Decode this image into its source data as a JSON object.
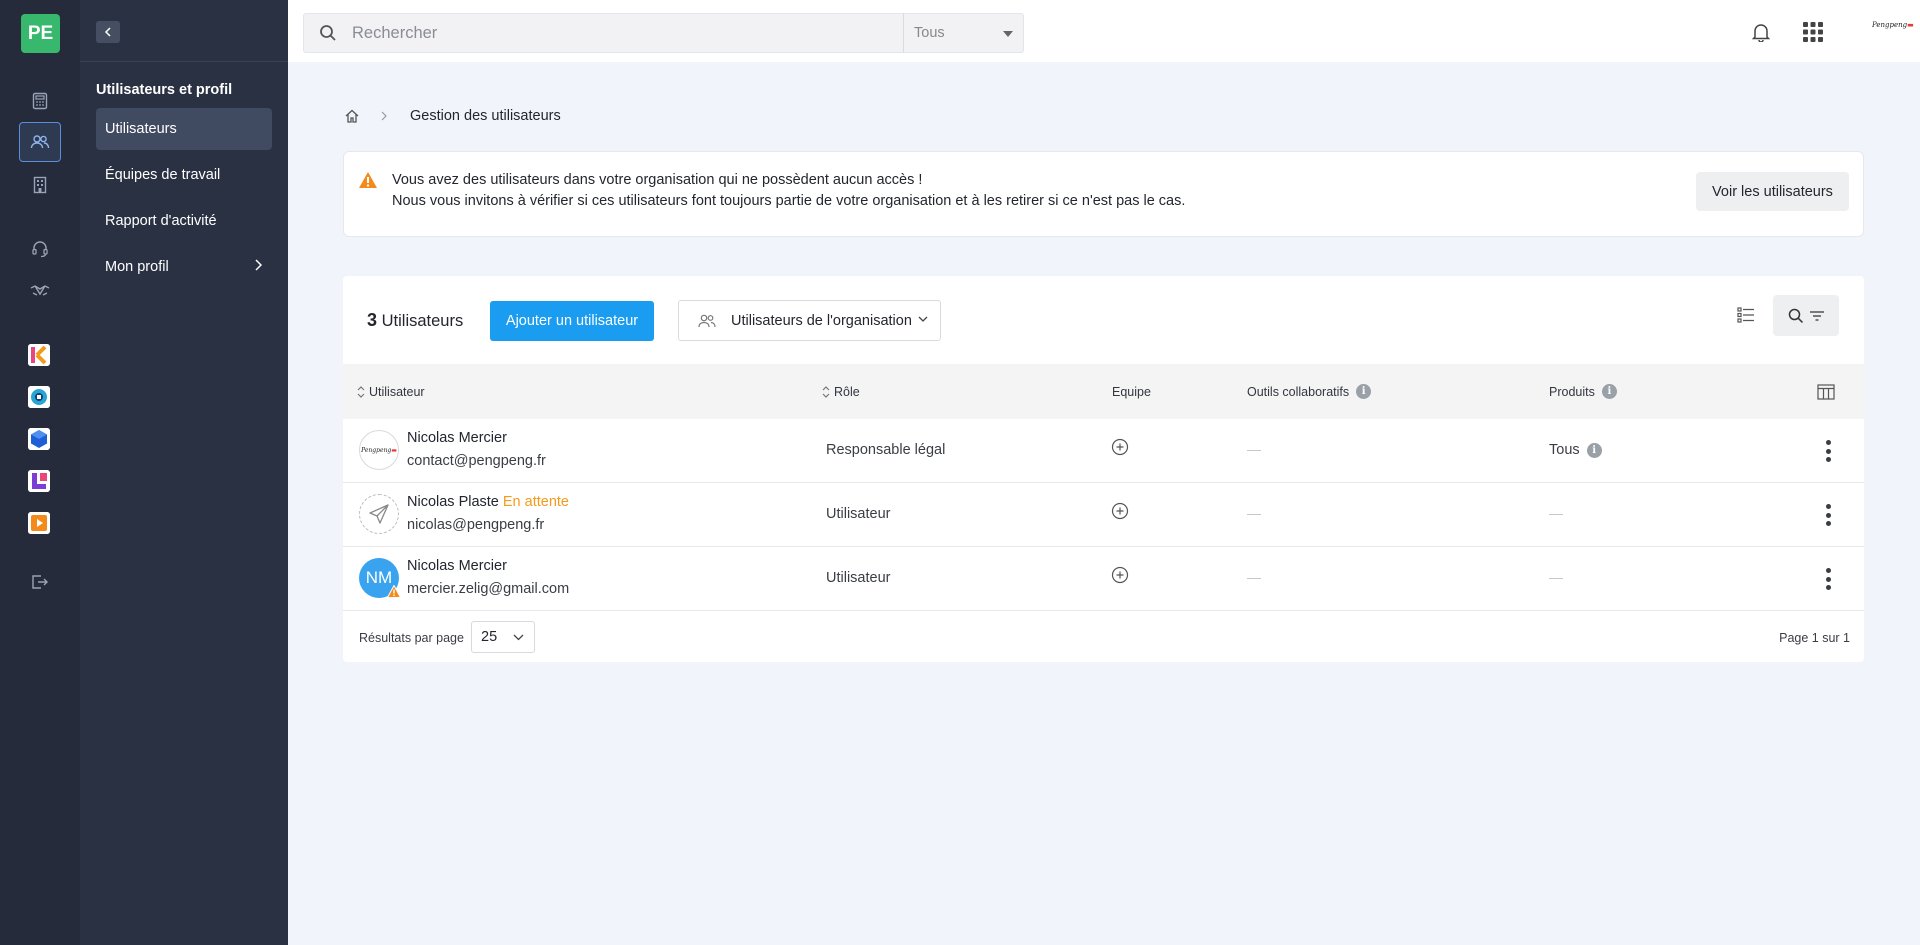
{
  "rail": {
    "logo_text": "PE",
    "logo_color": "#38b86c",
    "accent": "#5a8fd8",
    "icons": [
      "calculator-icon",
      "users-icon",
      "building-icon",
      "headset-icon",
      "handshake-icon"
    ],
    "apps": [
      {
        "name": "k-app-icon",
        "color": "#e8467c"
      },
      {
        "name": "blue-circle-app-icon",
        "color": "#27a6d6"
      },
      {
        "name": "blue-cube-app-icon",
        "color": "#1f5fd6"
      },
      {
        "name": "purple-app-icon",
        "color": "#7b3fd6"
      },
      {
        "name": "orange-play-app-icon",
        "color": "#f28a1c"
      }
    ]
  },
  "subnav": {
    "section_title": "Utilisateurs et profil",
    "items": [
      {
        "label": "Utilisateurs",
        "active": true
      },
      {
        "label": "Équipes de travail"
      },
      {
        "label": "Rapport d'activité"
      },
      {
        "label": "Mon profil",
        "has_chevron": true
      }
    ]
  },
  "topbar": {
    "search_placeholder": "Rechercher",
    "scope_value": "Tous",
    "brand_text": "Pengpeng"
  },
  "breadcrumb": {
    "current": "Gestion des utilisateurs"
  },
  "alert": {
    "line1": "Vous avez des utilisateurs dans votre organisation qui ne possèdent aucun accès !",
    "line2": "Nous vous invitons à vérifier si ces utilisateurs font toujours partie de votre organisation et à les retirer si ce n'est pas le cas.",
    "button": "Voir les utilisateurs"
  },
  "users": {
    "count": "3",
    "count_label": "Utilisateurs",
    "add_button": "Ajouter un utilisateur",
    "filter_dropdown": "Utilisateurs de l'organisation",
    "columns": {
      "user": "Utilisateur",
      "role": "Rôle",
      "team": "Equipe",
      "tools": "Outils collaboratifs",
      "products": "Produits"
    },
    "rows": [
      {
        "name": "Nicolas Mercier",
        "status": "",
        "email": "contact@pengpeng.fr",
        "role": "Responsable légal",
        "products": "Tous",
        "avatar": "logo"
      },
      {
        "name": "Nicolas Plaste",
        "status": "En attente",
        "email": "nicolas@pengpeng.fr",
        "role": "Utilisateur",
        "products": "",
        "avatar": "pending"
      },
      {
        "name": "Nicolas Mercier",
        "status": "",
        "email": "mercier.zelig@gmail.com",
        "role": "Utilisateur",
        "products": "",
        "avatar": "initials",
        "initials": "NM"
      }
    ],
    "footer": {
      "per_page_label": "Résultats par page",
      "per_page_value": "25",
      "pagination": "Page 1 sur 1"
    }
  }
}
